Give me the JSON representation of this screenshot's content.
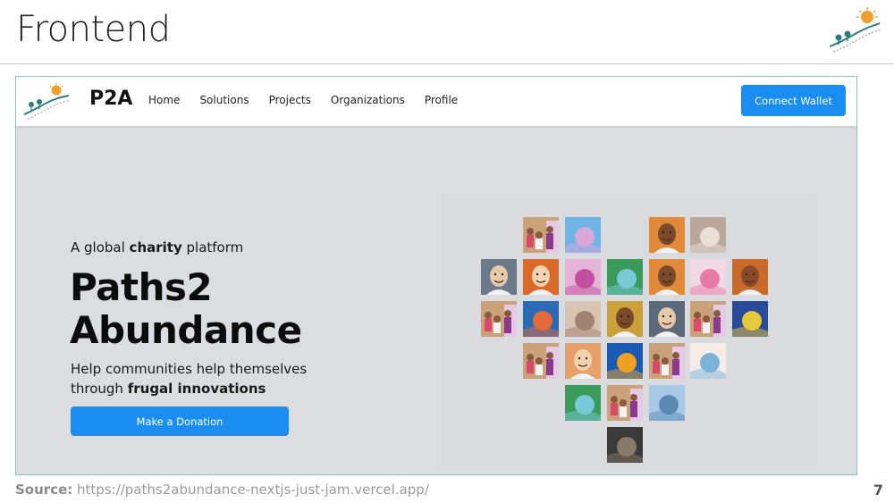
{
  "slide": {
    "title": "Frontend",
    "source_label": "Source:",
    "source_url": "https://paths2abundance-nextjs-just-jam.vercel.app/",
    "page_number": "7"
  },
  "app": {
    "brand": "P2A",
    "nav": [
      {
        "label": "Home"
      },
      {
        "label": "Solutions"
      },
      {
        "label": "Projects"
      },
      {
        "label": "Organizations"
      },
      {
        "label": "Profile"
      }
    ],
    "connect_wallet": "Connect Wallet",
    "hero": {
      "kicker_pre": "A global ",
      "kicker_bold": "charity",
      "kicker_post": " platform",
      "title_line1": "Paths2",
      "title_line2": "Abundance",
      "sub_line1": "Help communities help themselves",
      "sub_line2_pre": "through ",
      "sub_line2_bold": "frugal innovations",
      "donate": "Make a Donation"
    }
  },
  "colors": {
    "accent": "#1a8ef0",
    "frame_border": "#8ec2bd",
    "hero_bg": "#dcdde1",
    "logo_teal": "#2a7f7a",
    "logo_orange": "#f0a030"
  },
  "heart_tiles": [
    {
      "kind": "people",
      "c1": "#8a5a3c",
      "c2": "#c9a27a"
    },
    {
      "kind": "graphic",
      "c1": "#6fb4e6",
      "c2": "#d9a7d9"
    },
    {
      "kind": "face",
      "c1": "#e08a3a",
      "c2": "#7a4a2a"
    },
    {
      "kind": "graphic",
      "c1": "#b9a79a",
      "c2": "#e8e0d8"
    },
    {
      "kind": "face",
      "c1": "#6a7a8a",
      "c2": "#e6c9a8"
    },
    {
      "kind": "face",
      "c1": "#d96a2a",
      "c2": "#f2d2b0"
    },
    {
      "kind": "graphic",
      "c1": "#e6b4d9",
      "c2": "#c44fa0"
    },
    {
      "kind": "graphic",
      "c1": "#3a9a5a",
      "c2": "#7ac9d9"
    },
    {
      "kind": "face",
      "c1": "#e08a3a",
      "c2": "#7a4a2a"
    },
    {
      "kind": "graphic",
      "c1": "#f2d9e6",
      "c2": "#e67aa5"
    },
    {
      "kind": "face",
      "c1": "#c96a2a",
      "c2": "#8a4a2a"
    },
    {
      "kind": "people",
      "c1": "#8a5a3c",
      "c2": "#c9a27a"
    },
    {
      "kind": "graphic",
      "c1": "#2a6ab4",
      "c2": "#e66a3a"
    },
    {
      "kind": "graphic",
      "c1": "#d9c4b4",
      "c2": "#a08270"
    },
    {
      "kind": "face",
      "c1": "#c9a03a",
      "c2": "#7a4a2a"
    },
    {
      "kind": "face",
      "c1": "#5a6a7a",
      "c2": "#e6c9a8"
    },
    {
      "kind": "people",
      "c1": "#8a5a3c",
      "c2": "#c9a27a"
    },
    {
      "kind": "graphic",
      "c1": "#2a4a9a",
      "c2": "#e6c93a"
    },
    {
      "kind": "people",
      "c1": "#8a5a3c",
      "c2": "#c9a27a"
    },
    {
      "kind": "face",
      "c1": "#e6a06a",
      "c2": "#f2d2b0"
    },
    {
      "kind": "graphic",
      "c1": "#1a5ab4",
      "c2": "#f2a020"
    },
    {
      "kind": "people",
      "c1": "#8a5a3c",
      "c2": "#c9a27a"
    },
    {
      "kind": "graphic",
      "c1": "#f5ece6",
      "c2": "#7ab4d9"
    },
    {
      "kind": "graphic",
      "c1": "#3a9a5a",
      "c2": "#7ac9d9"
    },
    {
      "kind": "people",
      "c1": "#8a5a3c",
      "c2": "#c9a27a"
    },
    {
      "kind": "graphic",
      "c1": "#a8c9e6",
      "c2": "#5a8ab4"
    },
    {
      "kind": "graphic",
      "c1": "#3a3a3a",
      "c2": "#8a7a6a"
    }
  ]
}
